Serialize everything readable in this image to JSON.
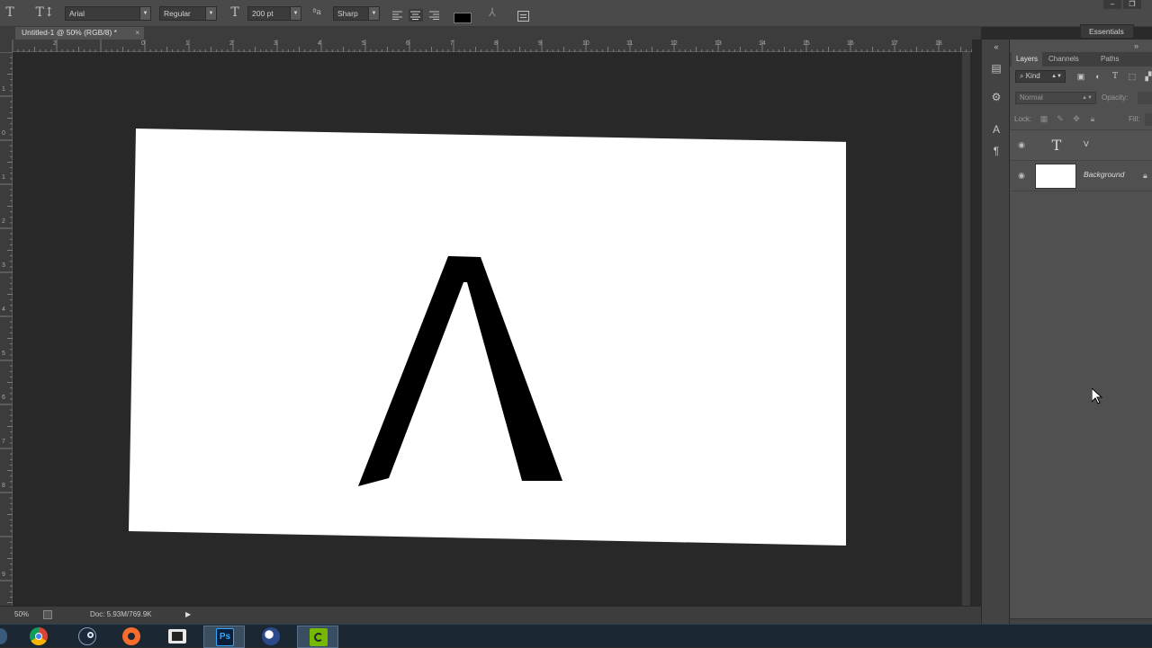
{
  "options_bar": {
    "font_family": "Arial",
    "font_style": "Regular",
    "font_size": "200 pt",
    "antialias": "Sharp",
    "text_color": "#000000"
  },
  "workspace": "Essentials",
  "document_tab": {
    "title": "Untitled-1 @ 50% (RGB/8) *",
    "close": "×"
  },
  "rulers": {
    "top": [
      "2",
      "0",
      "1",
      "2",
      "3",
      "4",
      "5",
      "6",
      "7",
      "8",
      "9",
      "10",
      "11",
      "12",
      "13",
      "14",
      "15",
      "16",
      "17",
      "18"
    ],
    "left": [
      "1",
      "0",
      "1",
      "2",
      "3",
      "4",
      "5",
      "6",
      "7",
      "8",
      "9"
    ]
  },
  "canvas": {
    "text": "V",
    "background": "#ffffff",
    "text_color": "#000000"
  },
  "status_bar": {
    "zoom": "50%",
    "doc_info": "Doc: 5.93M/769.9K"
  },
  "layers_panel": {
    "tabs": [
      "Layers",
      "Channels",
      "Paths"
    ],
    "active_tab": "Layers",
    "filter_kind": "Kind",
    "blend_mode": "Normal",
    "opacity_label": "Opacity:",
    "lock_label": "Lock:",
    "fill_label": "Fill:",
    "layers": [
      {
        "name": "V",
        "type": "text",
        "visible": true
      },
      {
        "name": "Background",
        "type": "background",
        "visible": true,
        "locked": true
      }
    ]
  },
  "taskbar": {
    "apps": [
      "chrome-icon",
      "steam-icon",
      "origin-icon",
      "video-editor-icon",
      "photoshop-icon",
      "cinema4d-icon",
      "nvidia-icon"
    ],
    "active_app": "photoshop-icon",
    "photoshop_label": "Ps"
  },
  "colors": {
    "panel_bg": "#505050",
    "canvas_area": "#282828",
    "document_bg": "#ffffff",
    "taskbar": "#1b2733"
  }
}
